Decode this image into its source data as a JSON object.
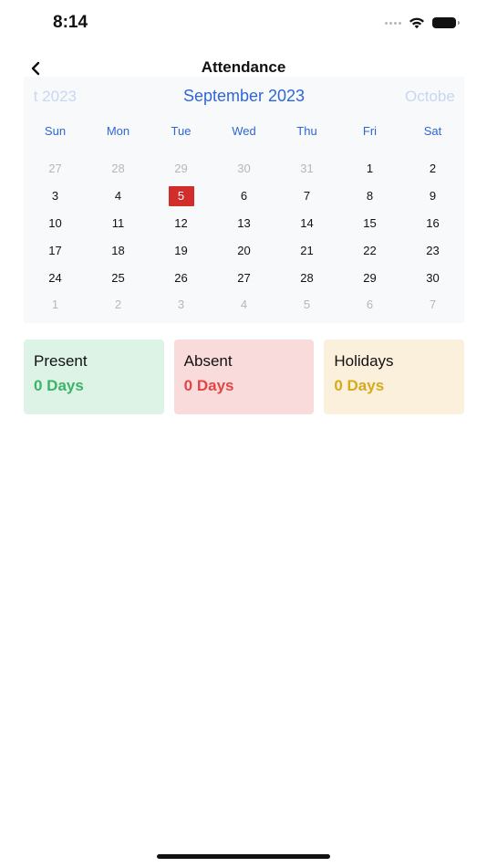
{
  "status_bar": {
    "time": "8:14"
  },
  "nav": {
    "title": "Attendance"
  },
  "calendar": {
    "prev_month": "t 2023",
    "current_month": "September 2023",
    "next_month": "Octobe",
    "weekdays": [
      "Sun",
      "Mon",
      "Tue",
      "Wed",
      "Thu",
      "Fri",
      "Sat"
    ],
    "weeks": [
      [
        {
          "d": "27",
          "m": true
        },
        {
          "d": "28",
          "m": true
        },
        {
          "d": "29",
          "m": true
        },
        {
          "d": "30",
          "m": true
        },
        {
          "d": "31",
          "m": true
        },
        {
          "d": "1"
        },
        {
          "d": "2"
        }
      ],
      [
        {
          "d": "3"
        },
        {
          "d": "4"
        },
        {
          "d": "5",
          "today": true
        },
        {
          "d": "6"
        },
        {
          "d": "7"
        },
        {
          "d": "8"
        },
        {
          "d": "9"
        }
      ],
      [
        {
          "d": "10"
        },
        {
          "d": "11"
        },
        {
          "d": "12"
        },
        {
          "d": "13"
        },
        {
          "d": "14"
        },
        {
          "d": "15"
        },
        {
          "d": "16"
        }
      ],
      [
        {
          "d": "17"
        },
        {
          "d": "18"
        },
        {
          "d": "19"
        },
        {
          "d": "20"
        },
        {
          "d": "21"
        },
        {
          "d": "22"
        },
        {
          "d": "23"
        }
      ],
      [
        {
          "d": "24"
        },
        {
          "d": "25"
        },
        {
          "d": "26"
        },
        {
          "d": "27"
        },
        {
          "d": "28"
        },
        {
          "d": "29"
        },
        {
          "d": "30"
        }
      ],
      [
        {
          "d": "1",
          "m": true
        },
        {
          "d": "2",
          "m": true
        },
        {
          "d": "3",
          "m": true
        },
        {
          "d": "4",
          "m": true
        },
        {
          "d": "5",
          "m": true
        },
        {
          "d": "6",
          "m": true
        },
        {
          "d": "7",
          "m": true
        }
      ]
    ],
    "today_color": "#d12d2b",
    "accent_color": "#2f66d6"
  },
  "summary": {
    "present": {
      "label": "Present",
      "value": "0 Days",
      "color": "#3cb468",
      "bg": "#dcf3e6"
    },
    "absent": {
      "label": "Absent",
      "value": "0 Days",
      "color": "#e14646",
      "bg": "#fadbdb"
    },
    "holidays": {
      "label": "Holidays",
      "value": "0 Days",
      "color": "#d6aa1c",
      "bg": "#fbf0dc"
    }
  },
  "icons": {
    "back": "chevron-left-icon",
    "wifi": "wifi-icon",
    "battery": "battery-icon",
    "signal": "signal-icon"
  }
}
